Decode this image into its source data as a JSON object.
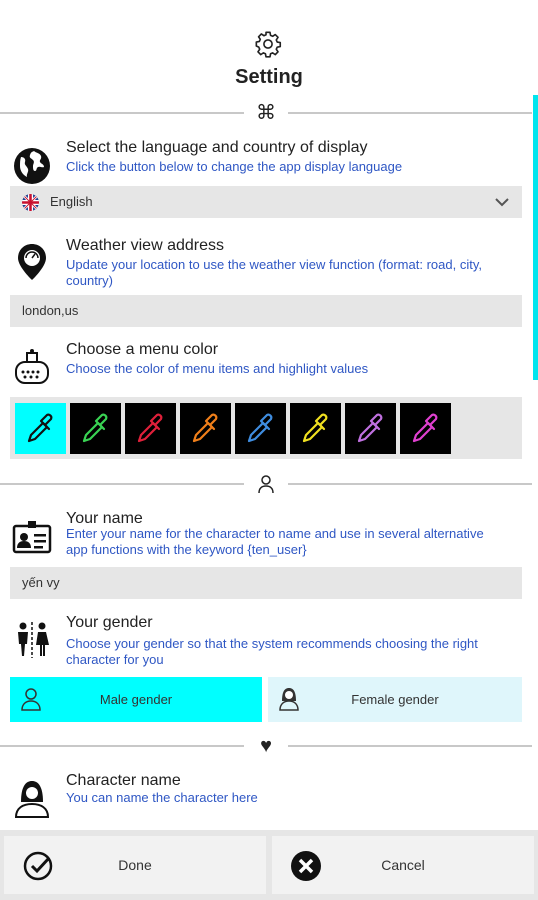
{
  "header": {
    "title": "Setting",
    "icon": "gear-icon"
  },
  "sections": {
    "language": {
      "title": "Select the language and country of display",
      "desc": "Click the button below to change the app display language",
      "selected": "English"
    },
    "weather": {
      "title": "Weather view address",
      "desc": "Update your location to use the weather view function (format: road, city, country)",
      "value": "london,us"
    },
    "menu_color": {
      "title": "Choose a menu color",
      "desc": "Choose the color of menu items and highlight values",
      "colors": [
        "#00bcd4",
        "#39d353",
        "#e0203a",
        "#f07f1a",
        "#3f8de0",
        "#f0e020",
        "#c070e0",
        "#e040d0"
      ],
      "selected_index": 0
    },
    "name": {
      "title": "Your name",
      "desc": "Enter your name for the character to name and use in several alternative app functions with the keyword {ten_user}",
      "value": "yến vy"
    },
    "gender": {
      "title": "Your gender",
      "desc": "Choose your gender so that the system recommends choosing the right character for you",
      "male_label": "Male gender",
      "female_label": "Female gender",
      "selected": "male",
      "selected_color": "#00ffff",
      "unselected_color": "#dff6fb"
    },
    "character": {
      "title": "Character name",
      "desc": "You can name the character here"
    }
  },
  "footer": {
    "done_label": "Done",
    "cancel_label": "Cancel"
  },
  "accent": "#00e5ee",
  "desc_color": "#2f57c4"
}
